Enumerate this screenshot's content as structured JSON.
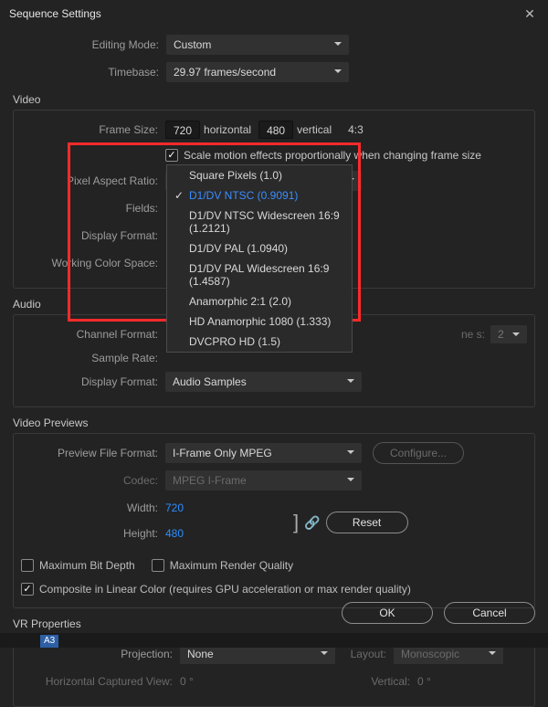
{
  "dialog": {
    "title": "Sequence Settings"
  },
  "editing_mode": {
    "label": "Editing Mode:",
    "value": "Custom"
  },
  "timebase": {
    "label": "Timebase:",
    "value": "29.97  frames/second"
  },
  "video": {
    "heading": "Video",
    "frame_size_label": "Frame Size:",
    "width": "720",
    "horizontal": "horizontal",
    "height": "480",
    "vertical": "vertical",
    "aspect_str": "4:3",
    "scale_checkbox": "Scale motion effects proportionally when changing frame size",
    "pixel_aspect_label": "Pixel Aspect Ratio:",
    "pixel_aspect_value": "D1/DV NTSC (0.9091)",
    "pixel_aspect_options": [
      "Square Pixels (1.0)",
      "D1/DV NTSC (0.9091)",
      "D1/DV NTSC Widescreen 16:9 (1.2121)",
      "D1/DV PAL (1.0940)",
      "D1/DV PAL Widescreen 16:9 (1.4587)",
      "Anamorphic 2:1 (2.0)",
      "HD Anamorphic 1080 (1.333)",
      "DVCPRO HD (1.5)"
    ],
    "pixel_aspect_selected_index": 1,
    "fields_label": "Fields:",
    "display_format_label": "Display Format:",
    "wcs_label": "Working Color Space:"
  },
  "audio": {
    "heading": "Audio",
    "channel_format_label": "Channel Format:",
    "channels_label_frag": "ne s:",
    "channels_value": "2",
    "sample_rate_label": "Sample Rate:",
    "display_format_label": "Display Format:",
    "display_format_value": "Audio Samples"
  },
  "previews": {
    "heading": "Video Previews",
    "pff_label": "Preview File Format:",
    "pff_value": "I-Frame Only MPEG",
    "configure": "Configure...",
    "codec_label": "Codec:",
    "codec_value": "MPEG I-Frame",
    "width_label": "Width:",
    "width_value": "720",
    "height_label": "Height:",
    "height_value": "480",
    "reset": "Reset",
    "max_bit_depth": "Maximum Bit Depth",
    "max_render_q": "Maximum Render Quality",
    "composite_linear": "Composite in Linear Color (requires GPU acceleration or max render quality)"
  },
  "vr": {
    "heading": "VR Properties",
    "projection_label": "Projection:",
    "projection_value": "None",
    "layout_label": "Layout:",
    "layout_value": "Monoscopic",
    "hcv_label": "Horizontal Captured View:",
    "hcv_value": "0 °",
    "vert_label": "Vertical:",
    "vert_value": "0 °"
  },
  "footer": {
    "ok": "OK",
    "cancel": "Cancel"
  },
  "timeline_tab": "A3"
}
